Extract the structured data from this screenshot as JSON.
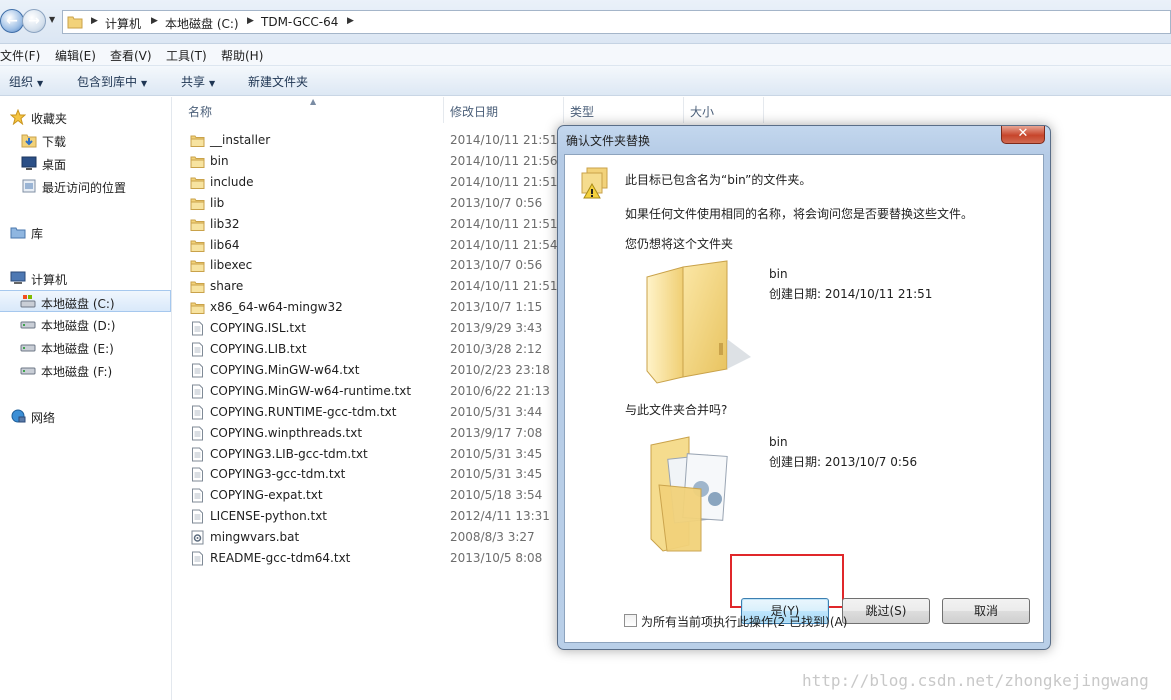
{
  "address": {
    "crumbs": [
      "计算机",
      "本地磁盘 (C:)",
      "TDM-GCC-64"
    ]
  },
  "menu": [
    "文件(F)",
    "编辑(E)",
    "查看(V)",
    "工具(T)",
    "帮助(H)"
  ],
  "toolbar": {
    "organize": "组织",
    "include_in_library": "包含到库中",
    "share": "共享",
    "new_folder": "新建文件夹"
  },
  "nav": {
    "favorites": "收藏夹",
    "downloads": "下载",
    "desktop": "桌面",
    "recent": "最近访问的位置",
    "libraries": "库",
    "computer": "计算机",
    "drive_c": "本地磁盘 (C:)",
    "drive_d": "本地磁盘 (D:)",
    "drive_e": "本地磁盘 (E:)",
    "drive_f": "本地磁盘 (F:)",
    "network": "网络"
  },
  "columns": {
    "name": "名称",
    "date": "修改日期",
    "type": "类型",
    "size": "大小"
  },
  "files": [
    {
      "name": "__installer",
      "date": "2014/10/11 21:51",
      "kind": "folder"
    },
    {
      "name": "bin",
      "date": "2014/10/11 21:56",
      "kind": "folder"
    },
    {
      "name": "include",
      "date": "2014/10/11 21:51",
      "kind": "folder"
    },
    {
      "name": "lib",
      "date": "2013/10/7 0:56",
      "kind": "folder"
    },
    {
      "name": "lib32",
      "date": "2014/10/11 21:51",
      "kind": "folder"
    },
    {
      "name": "lib64",
      "date": "2014/10/11 21:54",
      "kind": "folder"
    },
    {
      "name": "libexec",
      "date": "2013/10/7 0:56",
      "kind": "folder"
    },
    {
      "name": "share",
      "date": "2014/10/11 21:51",
      "kind": "folder"
    },
    {
      "name": "x86_64-w64-mingw32",
      "date": "2013/10/7 1:15",
      "kind": "folder"
    },
    {
      "name": "COPYING.ISL.txt",
      "date": "2013/9/29 3:43",
      "kind": "txt"
    },
    {
      "name": "COPYING.LIB.txt",
      "date": "2010/3/28 2:12",
      "kind": "txt"
    },
    {
      "name": "COPYING.MinGW-w64.txt",
      "date": "2010/2/23 23:18",
      "kind": "txt"
    },
    {
      "name": "COPYING.MinGW-w64-runtime.txt",
      "date": "2010/6/22 21:13",
      "kind": "txt"
    },
    {
      "name": "COPYING.RUNTIME-gcc-tdm.txt",
      "date": "2010/5/31 3:44",
      "kind": "txt"
    },
    {
      "name": "COPYING.winpthreads.txt",
      "date": "2013/9/17 7:08",
      "kind": "txt"
    },
    {
      "name": "COPYING3.LIB-gcc-tdm.txt",
      "date": "2010/5/31 3:45",
      "kind": "txt"
    },
    {
      "name": "COPYING3-gcc-tdm.txt",
      "date": "2010/5/31 3:45",
      "kind": "txt"
    },
    {
      "name": "COPYING-expat.txt",
      "date": "2010/5/18 3:54",
      "kind": "txt"
    },
    {
      "name": "LICENSE-python.txt",
      "date": "2012/4/11 13:31",
      "kind": "txt"
    },
    {
      "name": "mingwvars.bat",
      "date": "2008/8/3 3:27",
      "kind": "bat"
    },
    {
      "name": "README-gcc-tdm64.txt",
      "date": "2013/10/5 8:08",
      "kind": "txt"
    }
  ],
  "dialog": {
    "title": "确认文件夹替换",
    "message": "此目标已包含名为“bin”的文件夹。",
    "detail": "如果任何文件使用相同的名称，将会询问您是否要替换这些文件。",
    "question1": "您仍想将这个文件夹",
    "existing_name": "bin",
    "existing_date": "创建日期: 2014/10/11 21:51",
    "question2": "与此文件夹合并吗?",
    "incoming_name": "bin",
    "incoming_date": "创建日期: 2013/10/7 0:56",
    "yes": "是(Y)",
    "skip": "跳过(S)",
    "cancel": "取消",
    "apply_all": "为所有当前项执行此操作(2 已找到)(A)",
    "close_glyph": "✕"
  },
  "watermark": "http://blog.csdn.net/zhongkejingwang",
  "colors": {
    "highlight": "#e0272a",
    "folder": "#f2d27a",
    "dialog_frame": "#b9cfe8"
  }
}
